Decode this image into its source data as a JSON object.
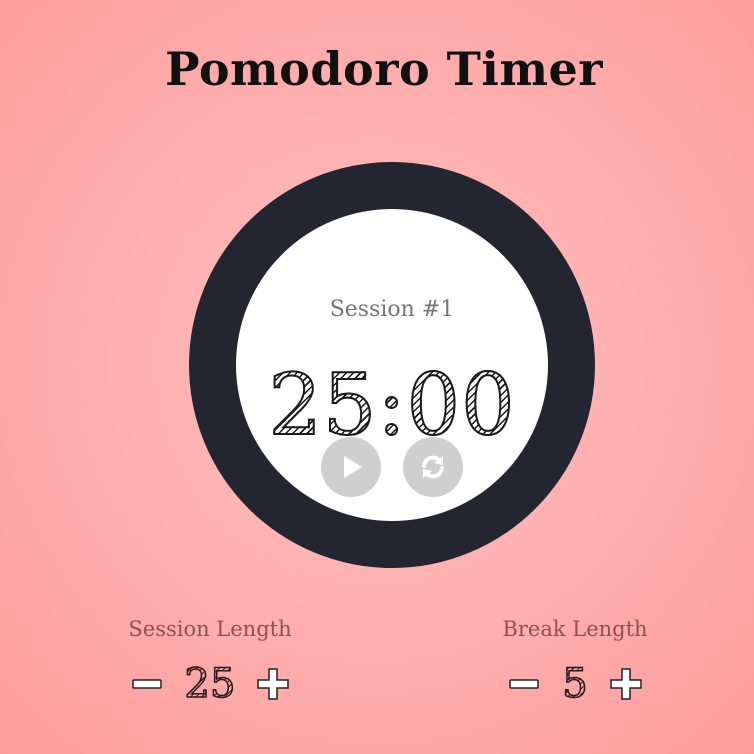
{
  "app": {
    "title": "Pomodoro Timer"
  },
  "timer": {
    "session_label": "Session #1",
    "time": "25:00",
    "play_icon": "play-icon",
    "reset_icon": "refresh-icon"
  },
  "settings": {
    "session": {
      "label": "Session Length",
      "value": "25",
      "decrement_icon": "minus-icon",
      "increment_icon": "plus-icon"
    },
    "break": {
      "label": "Break Length",
      "value": "5",
      "decrement_icon": "minus-icon",
      "increment_icon": "plus-icon"
    }
  },
  "colors": {
    "background": "#ffb0b0",
    "ring": "#232631",
    "face": "#ffffff",
    "control": "#cfcfcf"
  }
}
